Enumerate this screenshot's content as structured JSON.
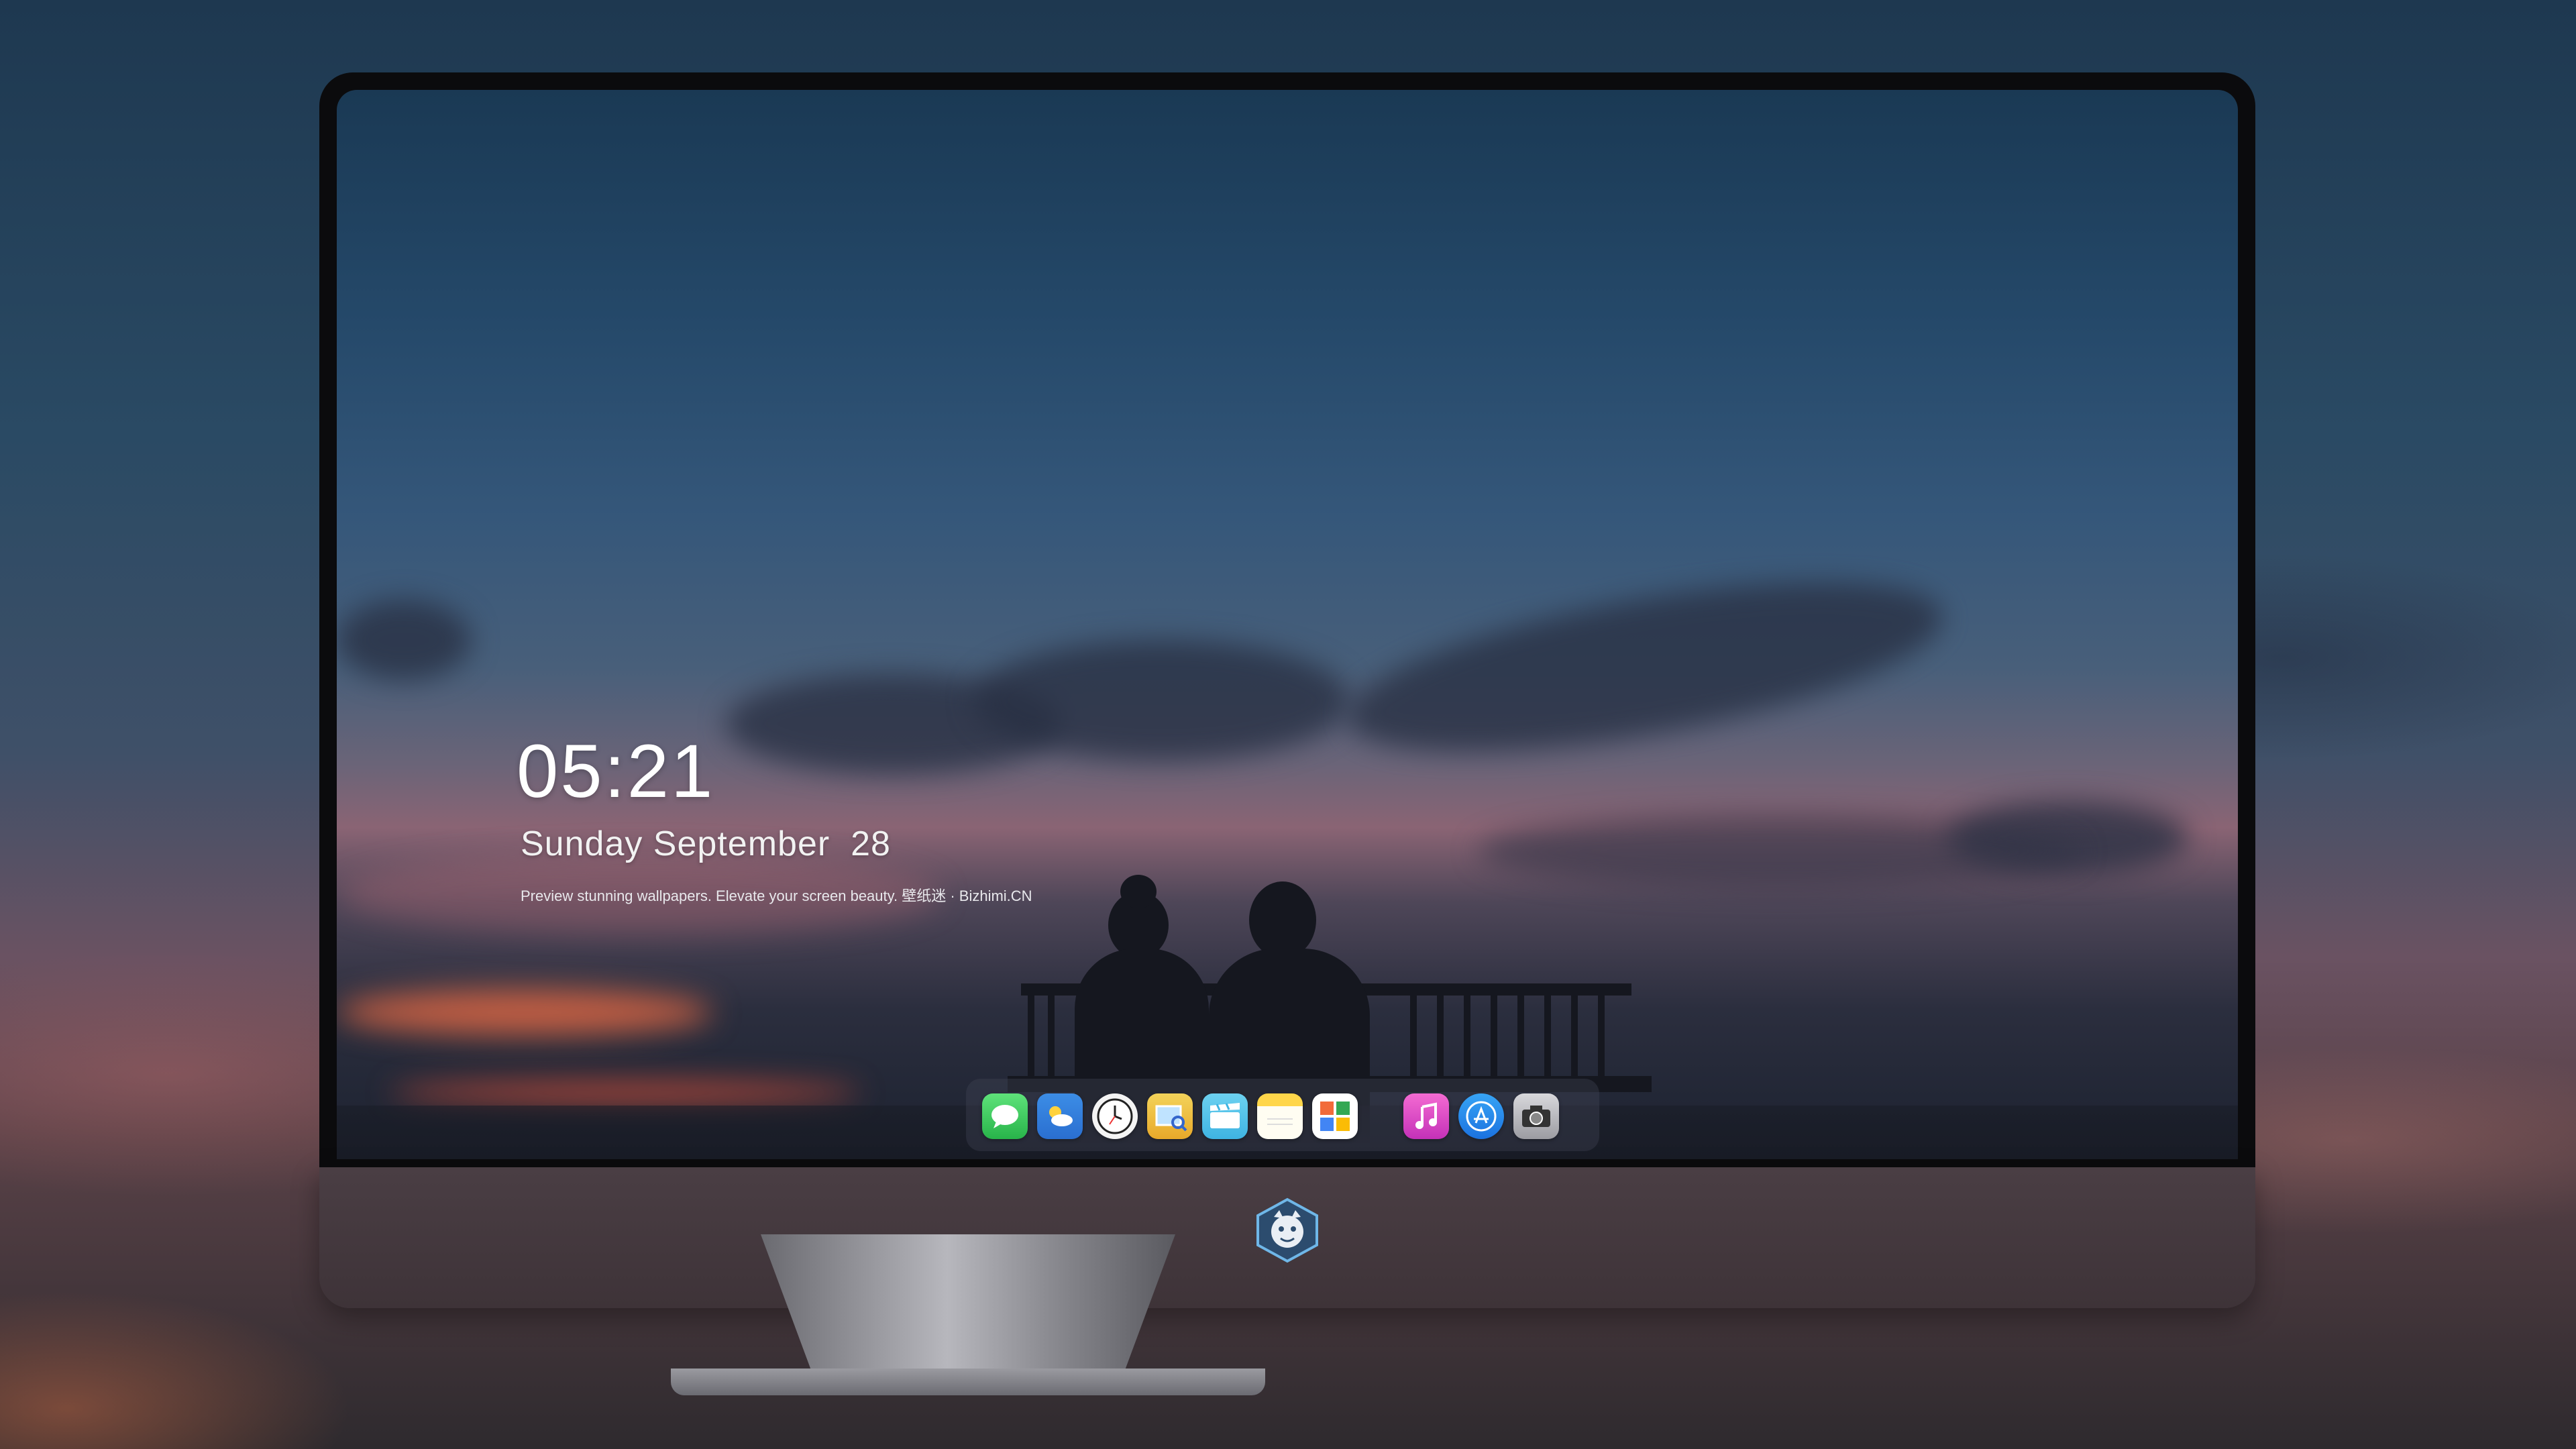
{
  "lock_screen": {
    "time": "05:21",
    "date": "Sunday September  28",
    "tagline": "Preview stunning wallpapers. Elevate your screen beauty. 壁纸迷 · Bizhimi.CN"
  },
  "dock": {
    "apps": [
      {
        "name": "messages-icon"
      },
      {
        "name": "weather-icon"
      },
      {
        "name": "clock-icon"
      },
      {
        "name": "preview-icon"
      },
      {
        "name": "clips-icon"
      },
      {
        "name": "notes-icon"
      },
      {
        "name": "photo-booth-icon"
      },
      {
        "name": "music-icon"
      },
      {
        "name": "app-store-icon"
      },
      {
        "name": "camera-icon"
      }
    ]
  },
  "colors": {
    "accent_music": "#e94cae",
    "accent_app_store": "#2a8cf0",
    "accent_messages": "#35c75a"
  }
}
